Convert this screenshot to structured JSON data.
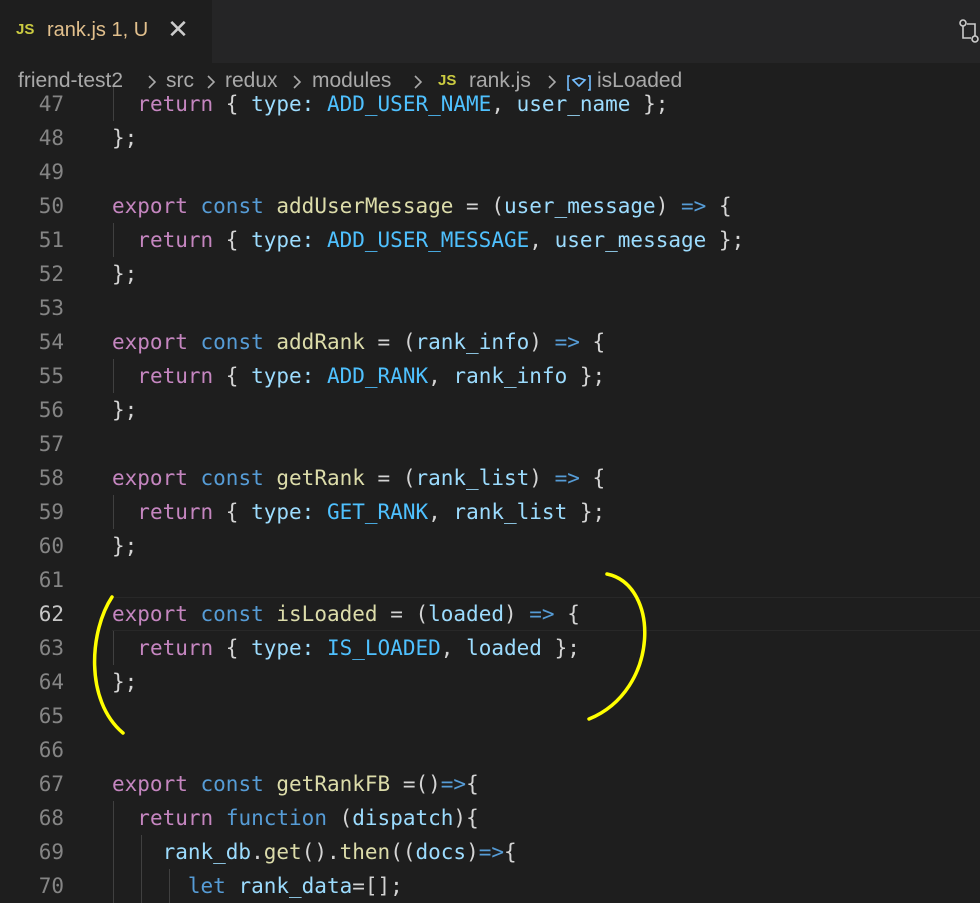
{
  "tab": {
    "lang": "JS",
    "title": "rank.js 1, U",
    "close": "✕"
  },
  "breadcrumb": {
    "items": [
      "friend-test2",
      "src",
      "redux",
      "modules",
      "rank.js",
      "isLoaded"
    ],
    "file_lang": "JS"
  },
  "lines": [
    {
      "n": "47",
      "text": "  return { type: ADD_USER_NAME, user_name };",
      "tokens": [
        [
          "  ",
          "pl"
        ],
        [
          "return",
          "k"
        ],
        [
          " { ",
          "pl"
        ],
        [
          "type:",
          "p"
        ],
        [
          " ",
          "pl"
        ],
        [
          "ADD_USER_NAME",
          "c"
        ],
        [
          ", ",
          "pl"
        ],
        [
          "user_name",
          "p"
        ],
        [
          " };",
          "pl"
        ]
      ]
    },
    {
      "n": "48",
      "text": "};",
      "tokens": [
        [
          "};",
          "pl"
        ]
      ]
    },
    {
      "n": "49",
      "text": "",
      "tokens": []
    },
    {
      "n": "50",
      "text": "export const addUserMessage = (user_message) => {",
      "tokens": [
        [
          "export",
          "k"
        ],
        [
          " ",
          "pl"
        ],
        [
          "const",
          "s"
        ],
        [
          " ",
          "pl"
        ],
        [
          "addUserMessage",
          "f"
        ],
        [
          " = (",
          "pl"
        ],
        [
          "user_message",
          "p"
        ],
        [
          ") ",
          "pl"
        ],
        [
          "=>",
          "s"
        ],
        [
          " {",
          "pl"
        ]
      ]
    },
    {
      "n": "51",
      "text": "  return { type: ADD_USER_MESSAGE, user_message };",
      "tokens": [
        [
          "  ",
          "pl"
        ],
        [
          "return",
          "k"
        ],
        [
          " { ",
          "pl"
        ],
        [
          "type:",
          "p"
        ],
        [
          " ",
          "pl"
        ],
        [
          "ADD_USER_MESSAGE",
          "c"
        ],
        [
          ", ",
          "pl"
        ],
        [
          "user_message",
          "p"
        ],
        [
          " };",
          "pl"
        ]
      ]
    },
    {
      "n": "52",
      "text": "};",
      "tokens": [
        [
          "};",
          "pl"
        ]
      ]
    },
    {
      "n": "53",
      "text": "",
      "tokens": []
    },
    {
      "n": "54",
      "text": "export const addRank = (rank_info) => {",
      "tokens": [
        [
          "export",
          "k"
        ],
        [
          " ",
          "pl"
        ],
        [
          "const",
          "s"
        ],
        [
          " ",
          "pl"
        ],
        [
          "addRank",
          "f"
        ],
        [
          " = (",
          "pl"
        ],
        [
          "rank_info",
          "p"
        ],
        [
          ") ",
          "pl"
        ],
        [
          "=>",
          "s"
        ],
        [
          " {",
          "pl"
        ]
      ]
    },
    {
      "n": "55",
      "text": "  return { type: ADD_RANK, rank_info };",
      "tokens": [
        [
          "  ",
          "pl"
        ],
        [
          "return",
          "k"
        ],
        [
          " { ",
          "pl"
        ],
        [
          "type:",
          "p"
        ],
        [
          " ",
          "pl"
        ],
        [
          "ADD_RANK",
          "c"
        ],
        [
          ", ",
          "pl"
        ],
        [
          "rank_info",
          "p"
        ],
        [
          " };",
          "pl"
        ]
      ]
    },
    {
      "n": "56",
      "text": "};",
      "tokens": [
        [
          "};",
          "pl"
        ]
      ]
    },
    {
      "n": "57",
      "text": "",
      "tokens": []
    },
    {
      "n": "58",
      "text": "export const getRank = (rank_list) => {",
      "tokens": [
        [
          "export",
          "k"
        ],
        [
          " ",
          "pl"
        ],
        [
          "const",
          "s"
        ],
        [
          " ",
          "pl"
        ],
        [
          "getRank",
          "f"
        ],
        [
          " = (",
          "pl"
        ],
        [
          "rank_list",
          "p"
        ],
        [
          ") ",
          "pl"
        ],
        [
          "=>",
          "s"
        ],
        [
          " {",
          "pl"
        ]
      ]
    },
    {
      "n": "59",
      "text": "  return { type: GET_RANK, rank_list };",
      "tokens": [
        [
          "  ",
          "pl"
        ],
        [
          "return",
          "k"
        ],
        [
          " { ",
          "pl"
        ],
        [
          "type:",
          "p"
        ],
        [
          " ",
          "pl"
        ],
        [
          "GET_RANK",
          "c"
        ],
        [
          ", ",
          "pl"
        ],
        [
          "rank_list",
          "p"
        ],
        [
          " };",
          "pl"
        ]
      ]
    },
    {
      "n": "60",
      "text": "};",
      "tokens": [
        [
          "};",
          "pl"
        ]
      ]
    },
    {
      "n": "61",
      "text": "",
      "tokens": []
    },
    {
      "n": "62",
      "text": "export const isLoaded = (loaded) => {",
      "tokens": [
        [
          "export",
          "k"
        ],
        [
          " ",
          "pl"
        ],
        [
          "const",
          "s"
        ],
        [
          " ",
          "pl"
        ],
        [
          "isLoaded",
          "f"
        ],
        [
          " = (",
          "pl"
        ],
        [
          "loaded",
          "p"
        ],
        [
          ") ",
          "pl"
        ],
        [
          "=>",
          "s"
        ],
        [
          " {",
          "pl"
        ]
      ],
      "active": true
    },
    {
      "n": "63",
      "text": "  return { type: IS_LOADED, loaded };",
      "tokens": [
        [
          "  ",
          "pl"
        ],
        [
          "return",
          "k"
        ],
        [
          " { ",
          "pl"
        ],
        [
          "type:",
          "p"
        ],
        [
          " ",
          "pl"
        ],
        [
          "IS_LOADED",
          "c"
        ],
        [
          ", ",
          "pl"
        ],
        [
          "loaded",
          "p"
        ],
        [
          " };",
          "pl"
        ]
      ]
    },
    {
      "n": "64",
      "text": "};",
      "tokens": [
        [
          "};",
          "pl"
        ]
      ]
    },
    {
      "n": "65",
      "text": "",
      "tokens": []
    },
    {
      "n": "66",
      "text": "",
      "tokens": []
    },
    {
      "n": "67",
      "text": "export const getRankFB =()=>{",
      "tokens": [
        [
          "export",
          "k"
        ],
        [
          " ",
          "pl"
        ],
        [
          "const",
          "s"
        ],
        [
          " ",
          "pl"
        ],
        [
          "getRankFB",
          "f"
        ],
        [
          " =()",
          "pl"
        ],
        [
          "=>",
          "s"
        ],
        [
          "{",
          "pl"
        ]
      ]
    },
    {
      "n": "68",
      "text": "  return function (dispatch){",
      "tokens": [
        [
          "  ",
          "pl"
        ],
        [
          "return",
          "k"
        ],
        [
          " ",
          "pl"
        ],
        [
          "function",
          "s"
        ],
        [
          " (",
          "pl"
        ],
        [
          "dispatch",
          "p"
        ],
        [
          "){",
          "pl"
        ]
      ]
    },
    {
      "n": "69",
      "text": "    rank_db.get().then((docs)=>{",
      "tokens": [
        [
          "    ",
          "pl"
        ],
        [
          "rank_db",
          "p"
        ],
        [
          ".",
          "pl"
        ],
        [
          "get",
          "f"
        ],
        [
          "().",
          "pl"
        ],
        [
          "then",
          "f"
        ],
        [
          "((",
          "pl"
        ],
        [
          "docs",
          "p"
        ],
        [
          ")",
          "pl"
        ],
        [
          "=>",
          "s"
        ],
        [
          "{",
          "pl"
        ]
      ]
    },
    {
      "n": "70",
      "text": "      let rank_data=[];",
      "tokens": [
        [
          "      ",
          "pl"
        ],
        [
          "let",
          "s"
        ],
        [
          " ",
          "pl"
        ],
        [
          "rank_data",
          "p"
        ],
        [
          "=[];",
          "pl"
        ]
      ]
    }
  ]
}
